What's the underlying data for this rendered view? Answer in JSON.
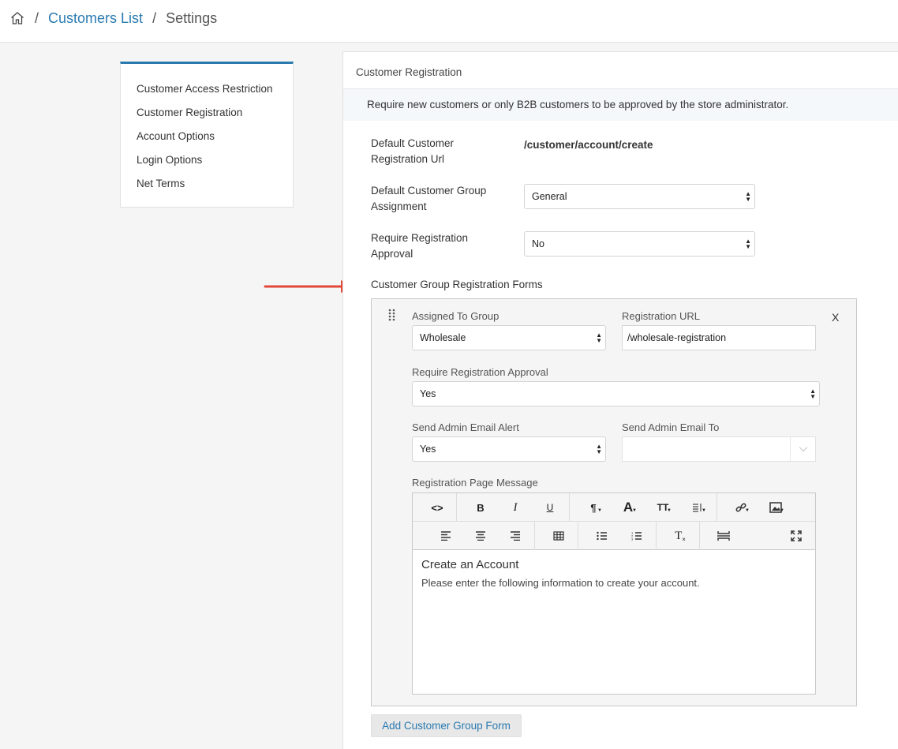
{
  "breadcrumb": {
    "home_icon": "home-icon",
    "separator": "/",
    "items": [
      {
        "label": "Customers List"
      },
      {
        "label": "Settings"
      }
    ]
  },
  "sidebar": {
    "accent_color": "#2a7ab0",
    "items": [
      {
        "label": "Customer Access Restriction"
      },
      {
        "label": "Customer Registration"
      },
      {
        "label": "Account Options"
      },
      {
        "label": "Login Options"
      },
      {
        "label": "Net Terms"
      }
    ]
  },
  "panel": {
    "title": "Customer Registration",
    "notice": "Require new customers or only B2B customers to be approved by the store administrator.",
    "fields": {
      "default_url": {
        "label": "Default Customer Registration Url",
        "value": "/customer/account/create"
      },
      "default_group": {
        "label": "Default Customer Group Assignment",
        "value": "General"
      },
      "require_approval": {
        "label": "Require Registration Approval",
        "value": "No"
      }
    },
    "group_forms_label": "Customer Group Registration Forms",
    "group_form": {
      "close_label": "X",
      "assigned_group": {
        "label": "Assigned To Group",
        "value": "Wholesale"
      },
      "registration_url": {
        "label": "Registration URL",
        "value": "/wholesale-registration"
      },
      "require_approval": {
        "label": "Require Registration Approval",
        "value": "Yes"
      },
      "send_alert": {
        "label": "Send Admin Email Alert",
        "value": "Yes"
      },
      "send_to": {
        "label": "Send Admin Email To",
        "value": ""
      },
      "message": {
        "label": "Registration Page Message",
        "toolbar": {
          "code_label": "<>",
          "bold_label": "B",
          "italic_label": "I",
          "underline_label": "U",
          "paragraph_label": "¶",
          "font_color_label": "A",
          "font_size_label": "TT",
          "clear_label": "T"
        },
        "heading": "Create an Account",
        "body": "Please enter the following information to create your account."
      }
    },
    "add_button_label": "Add Customer Group Form"
  }
}
